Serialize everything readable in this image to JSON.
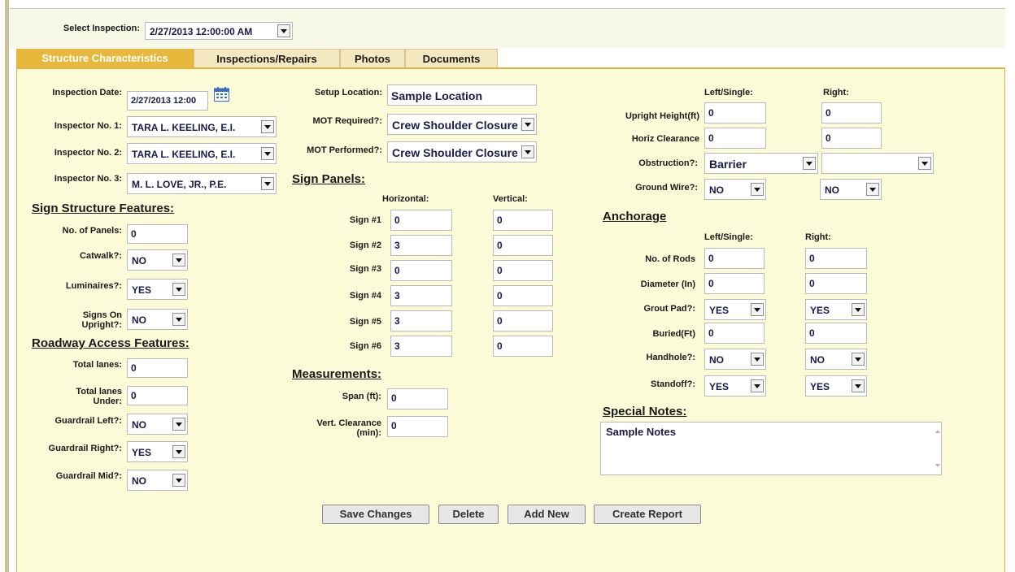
{
  "select_inspection": {
    "label": "Select Inspection:",
    "value": "2/27/2013 12:00:00 AM"
  },
  "tabs": [
    "Structure Characteristics",
    "Inspections/Repairs",
    "Photos",
    "Documents"
  ],
  "inspection_date": {
    "label": "Inspection Date:",
    "value": "2/27/2013 12:00"
  },
  "inspectors": [
    {
      "label": "Inspector No. 1:",
      "value": "TARA L. KEELING, E.I."
    },
    {
      "label": "Inspector No. 2:",
      "value": "TARA L. KEELING, E.I."
    },
    {
      "label": "Inspector No. 3:",
      "value": "M. L. LOVE, JR., P.E."
    }
  ],
  "sign_structure": {
    "heading": "Sign Structure Features:",
    "no_panels": {
      "label": "No. of Panels:",
      "value": "0"
    },
    "catwalk": {
      "label": "Catwalk?:",
      "value": "NO"
    },
    "luminaires": {
      "label": "Luminaires?:",
      "value": "YES"
    },
    "signs_on_upright": {
      "label_1": "Signs On",
      "label_2": "Upright?:",
      "value": "NO"
    }
  },
  "roadway": {
    "heading": "Roadway Access Features:",
    "total_lanes": {
      "label": "Total lanes:",
      "value": "0"
    },
    "total_lanes_under": {
      "label_1": "Total lanes",
      "label_2": "Under:",
      "value": "0"
    },
    "guardrail_left": {
      "label": "Guardrail Left?:",
      "value": "NO"
    },
    "guardrail_right": {
      "label": "Guardrail Right?:",
      "value": "YES"
    },
    "guardrail_mid": {
      "label": "Guardrail Mid?:",
      "value": "NO"
    }
  },
  "setup_location": {
    "label": "Setup Location:",
    "value": "Sample Location"
  },
  "mot_required": {
    "label": "MOT Required?:",
    "value": "Crew Shoulder Closure"
  },
  "mot_performed": {
    "label": "MOT Performed?:",
    "value": "Crew Shoulder Closure"
  },
  "sign_panels": {
    "heading": "Sign Panels:",
    "col_horizontal": "Horizontal:",
    "col_vertical": "Vertical:",
    "rows": [
      {
        "label": "Sign #1",
        "h": "0",
        "v": "0"
      },
      {
        "label": "Sign #2",
        "h": "3",
        "v": "0"
      },
      {
        "label": "Sign #3",
        "h": "0",
        "v": "0"
      },
      {
        "label": "Sign #4",
        "h": "3",
        "v": "0"
      },
      {
        "label": "Sign #5",
        "h": "3",
        "v": "0"
      },
      {
        "label": "Sign #6",
        "h": "3",
        "v": "0"
      }
    ]
  },
  "measurements": {
    "heading": "Measurements:",
    "span": {
      "label": "Span (ft):",
      "value": "0"
    },
    "vert_clearance": {
      "label_1": "Vert. Clearance",
      "label_2": "(min):",
      "value": "0"
    }
  },
  "upright": {
    "col_left": "Left/Single:",
    "col_right": "Right:",
    "height": {
      "label": "Upright Height(ft)",
      "left": "0",
      "right": "0"
    },
    "horiz": {
      "label": "Horiz Clearance",
      "left": "0",
      "right": "0"
    },
    "obstruction": {
      "label": "Obstruction?:",
      "left": "Barrier",
      "right": ""
    },
    "ground_wire": {
      "label": "Ground Wire?:",
      "left": "NO",
      "right": "NO"
    }
  },
  "anchorage": {
    "heading": "Anchorage",
    "col_left": "Left/Single:",
    "col_right": "Right:",
    "rods": {
      "label": "No. of Rods",
      "left": "0",
      "right": "0"
    },
    "diameter": {
      "label": "Diameter (In)",
      "left": "0",
      "right": "0"
    },
    "grout": {
      "label": "Grout Pad?:",
      "left": "YES",
      "right": "YES"
    },
    "buried": {
      "label": "Buried(Ft)",
      "left": "0",
      "right": "0"
    },
    "handhole": {
      "label": "Handhole?:",
      "left": "NO",
      "right": "NO"
    },
    "standoff": {
      "label": "Standoff?:",
      "left": "YES",
      "right": "YES"
    }
  },
  "special_notes": {
    "heading": "Special Notes:",
    "value": "Sample Notes"
  },
  "buttons": {
    "save": "Save Changes",
    "delete": "Delete",
    "add": "Add New",
    "report": "Create Report"
  },
  "colors": {
    "panel_bg": "#fbfbd8",
    "tab_active": "#e8b83c",
    "tab_inactive": "#f3e8bf",
    "border_accent": "#e0b340"
  }
}
